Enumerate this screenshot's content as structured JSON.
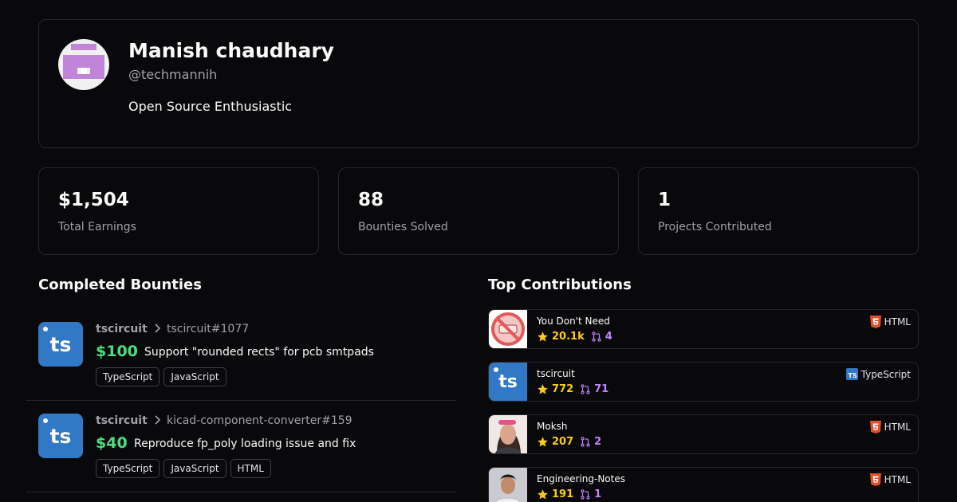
{
  "profile": {
    "name": "Manish chaudhary",
    "handle": "@techmannih",
    "bio": "Open Source Enthusiastic"
  },
  "stats": [
    {
      "value": "$1,504",
      "label": "Total Earnings"
    },
    {
      "value": "88",
      "label": "Bounties Solved"
    },
    {
      "value": "1",
      "label": "Projects Contributed"
    }
  ],
  "sections": {
    "completed": "Completed Bounties",
    "top": "Top Contributions"
  },
  "bounties": [
    {
      "logo": "ts",
      "org": "tscircuit",
      "issue": "tscircuit#1077",
      "amount": "$100",
      "title": "Support \"rounded rects\" for pcb smtpads",
      "tags": [
        "TypeScript",
        "JavaScript"
      ]
    },
    {
      "logo": "ts",
      "org": "tscircuit",
      "issue": "kicad-component-converter#159",
      "amount": "$40",
      "title": "Reproduce fp_poly loading issue and fix",
      "tags": [
        "TypeScript",
        "JavaScript",
        "HTML"
      ]
    }
  ],
  "contributions": [
    {
      "name": "You Don't Need",
      "stars": "20.1k",
      "prs": "4",
      "lang": "HTML",
      "image": "nope-sign"
    },
    {
      "name": "tscircuit",
      "logo": "ts",
      "stars": "772",
      "prs": "71",
      "lang": "TypeScript",
      "image": "tscircuit-logo"
    },
    {
      "name": "Moksh",
      "stars": "207",
      "prs": "2",
      "lang": "HTML",
      "image": "portrait-photo"
    },
    {
      "name": "Engineering-Notes",
      "stars": "191",
      "prs": "1",
      "lang": "HTML",
      "image": "portrait-photo"
    }
  ],
  "colors": {
    "background": "#09090b",
    "border": "#27272a",
    "amount": "#4ade80",
    "stars": "#facc15",
    "prs": "#c084fc",
    "typescript": "#3178c6",
    "html": "#e34f26"
  }
}
